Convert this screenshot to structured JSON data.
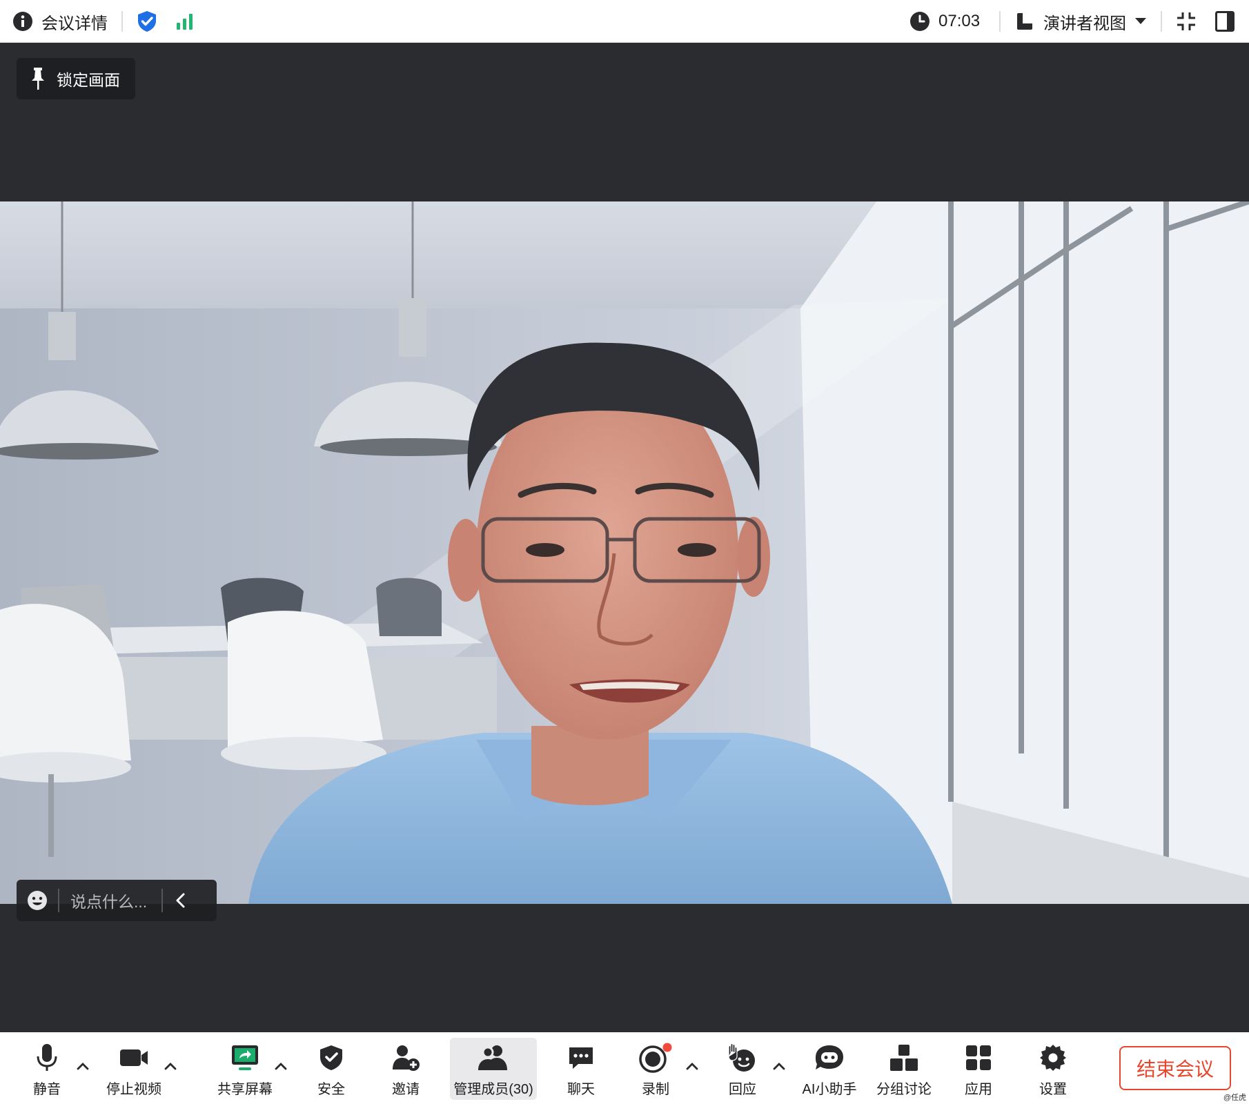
{
  "topbar": {
    "meeting_info_label": "会议详情",
    "timer": "07:03",
    "view_label": "演讲者视图"
  },
  "stage": {
    "lock_label": "锁定画面",
    "chat_placeholder": "说点什么..."
  },
  "toolbar": {
    "items": [
      {
        "label": "静音"
      },
      {
        "label": "停止视频"
      },
      {
        "label": "共享屏幕"
      },
      {
        "label": "安全"
      },
      {
        "label": "邀请"
      },
      {
        "label": "管理成员(30)"
      },
      {
        "label": "聊天"
      },
      {
        "label": "录制"
      },
      {
        "label": "回应"
      },
      {
        "label": "AI小助手"
      },
      {
        "label": "分组讨论"
      },
      {
        "label": "应用"
      },
      {
        "label": "设置"
      }
    ],
    "end_label": "结束会议"
  },
  "watermark": "@任虎",
  "colors": {
    "accent_blue": "#1f6fe5",
    "signal_green": "#22b573",
    "end_red": "#e5462c",
    "record_dot": "#f24a3a",
    "share_green": "#1aad6b"
  }
}
